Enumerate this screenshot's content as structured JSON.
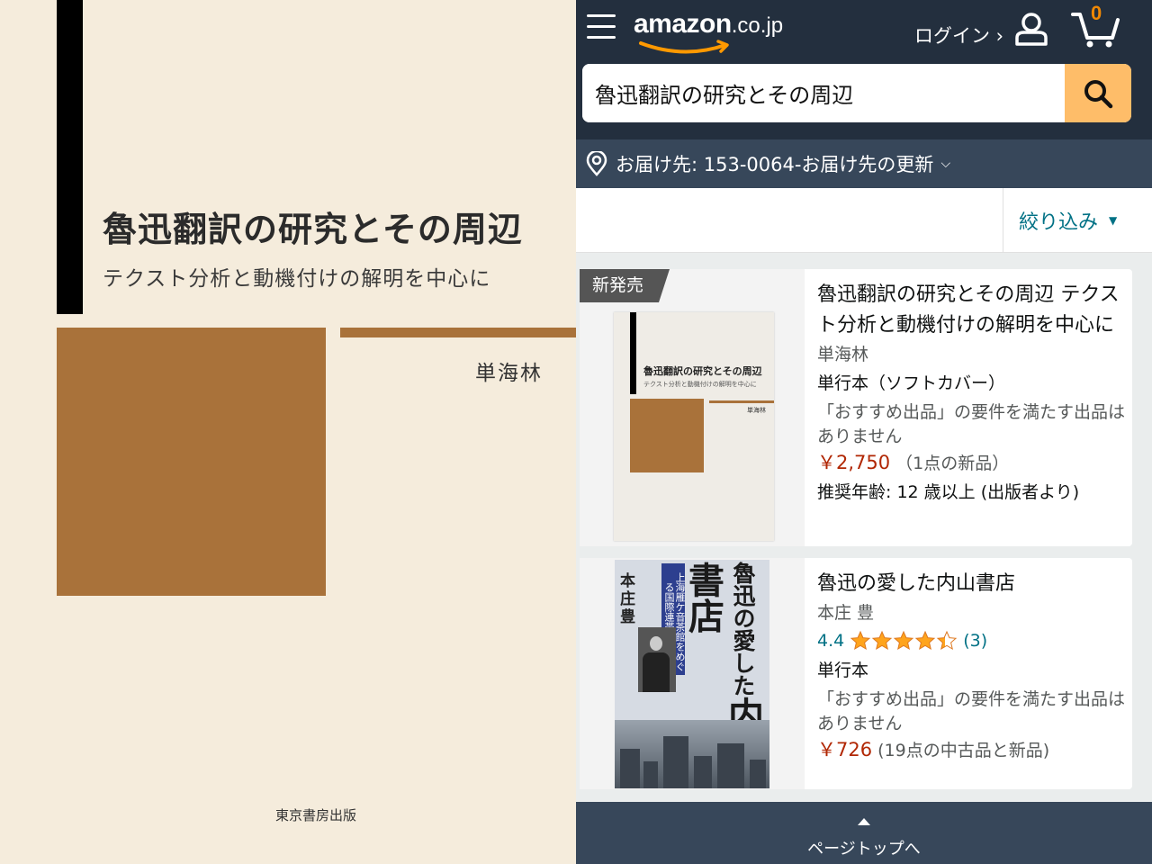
{
  "cover": {
    "title": "魯迅翻訳の研究とその周辺",
    "subtitle": "テクスト分析と動機付けの解明を中心に",
    "author": "単海林",
    "publisher": "東京書房出版"
  },
  "header": {
    "logo_word": "amazon",
    "logo_tld": ".co.jp",
    "login_label": "ログイン ›",
    "cart_count": "0",
    "icons": [
      "menu-icon",
      "user-icon",
      "cart-icon"
    ]
  },
  "search": {
    "value": "魯迅翻訳の研究とその周辺",
    "icon": "search-icon"
  },
  "delivery": {
    "text": "お届け先: 153-0064-お届け先の更新",
    "chevron": "⌵"
  },
  "filter": {
    "label": "絞り込み",
    "caret": "▼"
  },
  "results": [
    {
      "badge": "新発売",
      "title": "魯迅翻訳の研究とその周辺 テクスト分析と動機付けの解明を中心に",
      "author": "単海林",
      "format": "単行本（ソフトカバー）",
      "note": "「おすすめ出品」の要件を満たす出品はありません",
      "price": "￥2,750",
      "offers": "（1点の新品）",
      "age": "推奨年齢: 12 歳以上 (出版者より)",
      "thumb": {
        "title": "魯迅翻訳の研究とその周辺",
        "subtitle": "テクスト分析と動機付けの解明を中心に",
        "author": "単海林"
      }
    },
    {
      "title": "魯迅の愛した内山書店",
      "author": "本庄 豊",
      "rating_value": "4.4",
      "rating_count": "(3)",
      "stars": 4.4,
      "format": "単行本",
      "note": "「おすすめ出品」の要件を満たす出品はありません",
      "price": "￥726",
      "offers": "(19点の中古品と新品)",
      "thumb": {
        "author": "本庄 豊",
        "band": "上海雁ケ音茶館をめぐる国際連帯の物語",
        "line1": "魯迅の愛した",
        "line2": "内山書店"
      }
    }
  ],
  "page_top": {
    "label": "ページトップへ"
  },
  "colors": {
    "nav_dark": "#232f3e",
    "nav_mid": "#37475a",
    "search_button": "#febd69",
    "price_red": "#b12704",
    "link_teal": "#007185",
    "star_orange": "#ffa41c",
    "cover_brown": "#a9723a",
    "cover_bg": "#f5ecdc"
  }
}
